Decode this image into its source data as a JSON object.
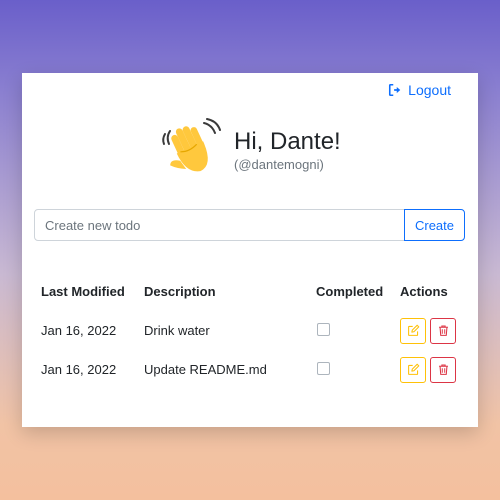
{
  "header": {
    "logout_label": "Logout",
    "greeting": "Hi, Dante!",
    "handle": "(@dantemogni)"
  },
  "new_todo": {
    "placeholder": "Create new todo",
    "value": "",
    "create_label": "Create"
  },
  "table": {
    "columns": [
      "Last Modified",
      "Description",
      "Completed",
      "Actions"
    ],
    "rows": [
      {
        "last_modified": "Jan 16, 2022",
        "description": "Drink water",
        "completed": false
      },
      {
        "last_modified": "Jan 16, 2022",
        "description": "Update README.md",
        "completed": false
      }
    ]
  },
  "icons": {
    "logout": "sign-out-icon",
    "wave": "waving-hand-emoji",
    "edit": "edit-icon",
    "delete": "trash-icon"
  },
  "colors": {
    "primary": "#0d6efd",
    "warning": "#ffc107",
    "danger": "#dc3545"
  }
}
